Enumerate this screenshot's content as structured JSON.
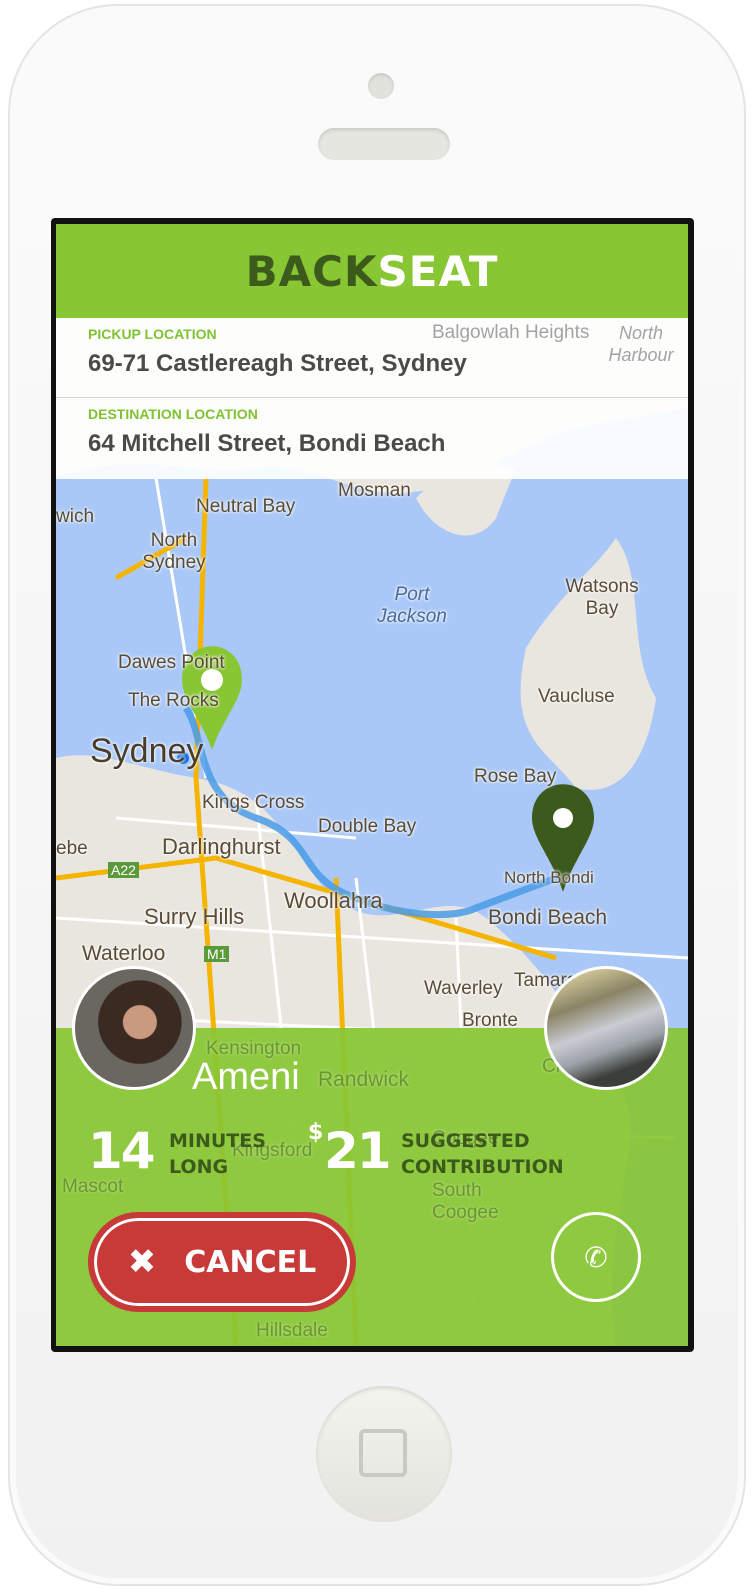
{
  "app": {
    "brand_part1": "BACK",
    "brand_part2": "SEAT"
  },
  "pickup": {
    "label": "PICKUP LOCATION",
    "value": "69-71 Castlereagh Street, Sydney"
  },
  "destination": {
    "label": "DESTINATION LOCATION",
    "value": "64 Mitchell Street, Bondi Beach"
  },
  "map": {
    "labels": [
      "Balgowlah Heights",
      "North Harbour",
      "Mosman",
      "Neutral Bay",
      "North Sydney",
      "Port Jackson",
      "Watsons Bay",
      "Dawes Point",
      "The Rocks",
      "Vaucluse",
      "Sydney",
      "Rose Bay",
      "Kings Cross",
      "Double Bay",
      "Darlinghurst",
      "North Bondi",
      "Surry Hills",
      "Woollahra",
      "Bondi Beach",
      "Waterloo",
      "Waverley",
      "Tamarama",
      "Bronte",
      "Kensington",
      "Randwick",
      "Clovelly",
      "Kingsford",
      "Coogee",
      "Mascot",
      "South Coogee",
      "Hillsdale",
      "wich",
      "ebe",
      "A22",
      "M1"
    ]
  },
  "driver": {
    "name": "Ameni"
  },
  "trip": {
    "minutes": "14",
    "minutes_unit_1": "MINUTES",
    "minutes_unit_2": "LONG",
    "currency": "$",
    "price": "21",
    "price_unit_1": "SUGGESTED",
    "price_unit_2": "CONTRIBUTION"
  },
  "actions": {
    "cancel_label": "CANCEL",
    "cancel_icon": "x-icon",
    "call_icon": "phone-icon"
  },
  "colors": {
    "brand_green": "#88c634",
    "dark_green": "#3c5a1b",
    "cancel_red": "#c83a38",
    "route_blue": "#4a9be6"
  }
}
